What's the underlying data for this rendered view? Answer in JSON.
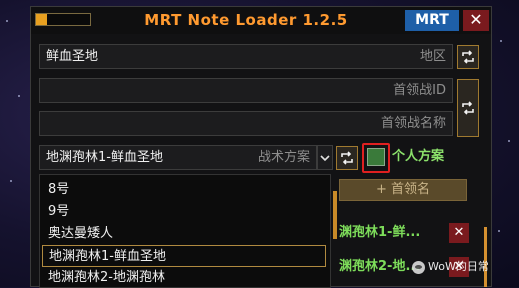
{
  "window": {
    "title": "MRT Note Loader 1.2.5",
    "progress": 0.2,
    "mrt_label": "MRT",
    "close_label": "✕"
  },
  "zone": {
    "value": "鲜血圣地",
    "placeholder": "地区"
  },
  "boss_id": {
    "value": "",
    "placeholder": "首领战ID"
  },
  "boss_name": {
    "value": "",
    "placeholder": "首领战名称"
  },
  "strategy": {
    "value": "地渊孢林1-鲜血圣地",
    "placeholder": "战术方案"
  },
  "personal": {
    "label": "个人方案",
    "checked": true
  },
  "dropdown": {
    "options": [
      "8号",
      "9号",
      "奥达曼矮人",
      "地渊孢林1-鲜血圣地",
      "地渊孢林2-地渊孢林"
    ],
    "selected_index": 3
  },
  "add_boss_label": "+ 首领名",
  "strategy_list": [
    {
      "label": "渊孢林1-鲜...",
      "remove": "✕"
    },
    {
      "label": "渊孢林2-地...",
      "remove": "✕"
    }
  ],
  "watermark": "WoW的日常",
  "colors": {
    "accent": "#ff9a30",
    "mrt_blue": "#1e5fa8",
    "close_red": "#7a1a1e",
    "checkbox_green": "#3a7a3a",
    "highlight_red": "#e02020"
  }
}
